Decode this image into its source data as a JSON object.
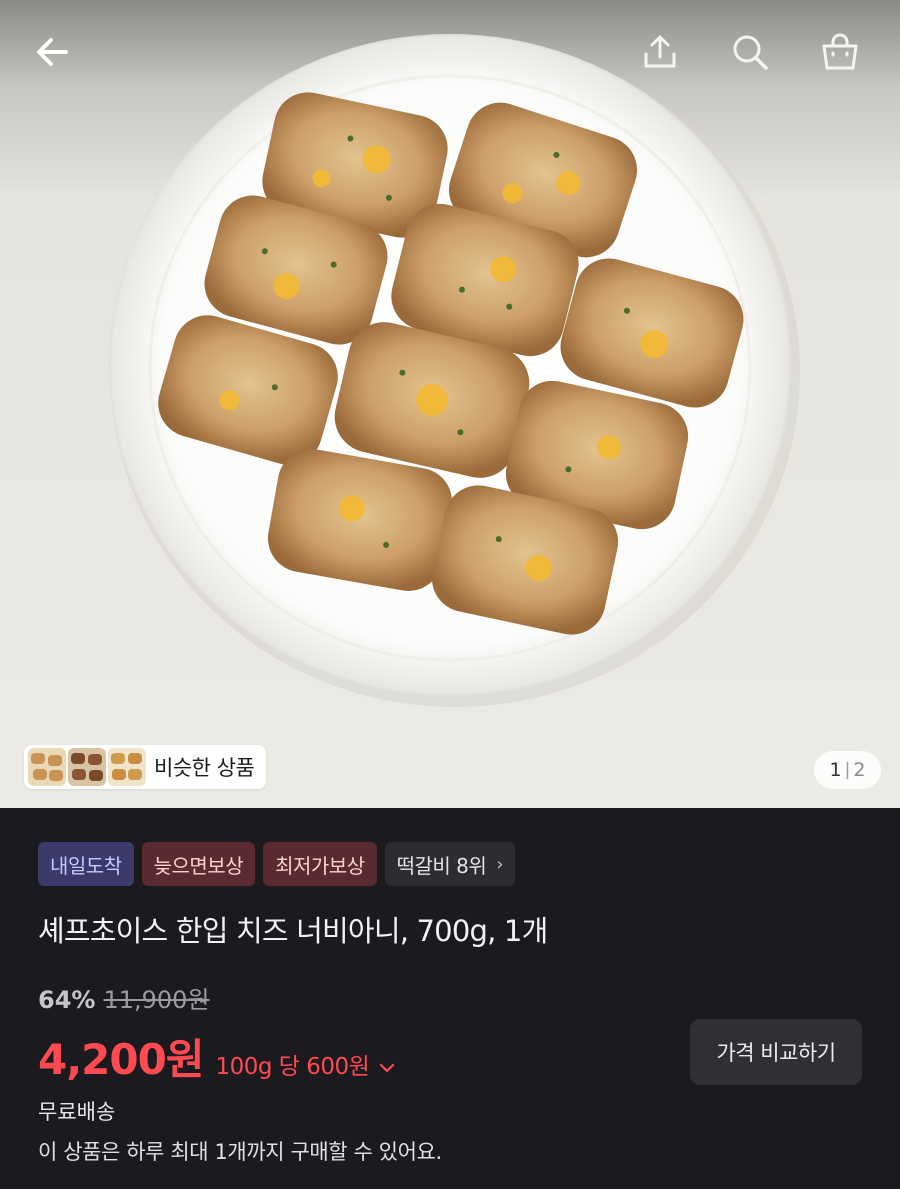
{
  "hero": {
    "image_alt": "product-photo-cheese-neobiani",
    "similar_label": "비슷한 상품",
    "page_current": "1",
    "page_total": "2"
  },
  "topbar": {
    "icons": [
      "back-arrow-icon",
      "share-icon",
      "search-icon",
      "shopping-bag-icon"
    ]
  },
  "badges": {
    "next_day": "내일도착",
    "late_comp": "늦으면보상",
    "lowest_comp": "최저가보상",
    "rank": "떡갈비 8위"
  },
  "product": {
    "title": "셰프초이스 한입 치즈 너비아니, 700g, 1개",
    "discount": "64%",
    "original_price": "11,900원",
    "sale_price": "4,200원",
    "unit_price": "100g 당 600원",
    "compare_label": "가격 비교하기",
    "shipping": "무료배송",
    "purchase_limit": "이 상품은 하루 최대 1개까지 구매할 수 있어요."
  },
  "colors": {
    "accent_red": "#ff4a52",
    "panel_bg": "#1b1b1f",
    "badge_blue": "#3b3a6b",
    "badge_red": "#5a2a30"
  }
}
